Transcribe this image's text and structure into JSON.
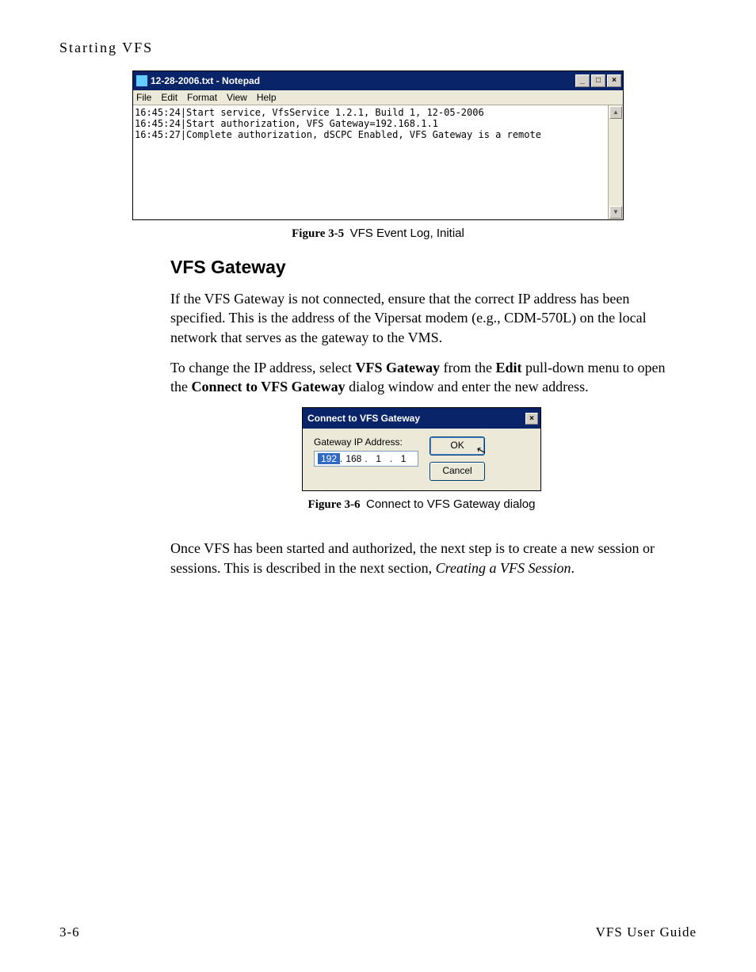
{
  "running_head": "Starting VFS",
  "notepad": {
    "title": "12-28-2006.txt - Notepad",
    "menu": [
      "File",
      "Edit",
      "Format",
      "View",
      "Help"
    ],
    "win_buttons": {
      "min": "_",
      "max": "□",
      "close": "×"
    },
    "scroll": {
      "up": "▲",
      "down": "▼"
    },
    "lines": [
      "16:45:24|Start service, VfsService 1.2.1, Build 1, 12-05-2006",
      "16:45:24|Start authorization, VFS Gateway=192.168.1.1",
      "16:45:27|Complete authorization, dSCPC Enabled, VFS Gateway is a remote"
    ]
  },
  "fig1": {
    "id": "Figure 3-5",
    "text": "VFS Event Log, Initial"
  },
  "section_heading": "VFS Gateway",
  "para1_a": "If the VFS Gateway is not connected, ensure that the correct IP address has been specified. This is the address of the Vipersat modem (e.g., CDM-570L) on the local network that serves as the gateway to the VMS.",
  "para2_a": "To change the IP address, select ",
  "para2_b": "VFS Gateway",
  "para2_c": " from the ",
  "para2_d": "Edit",
  "para2_e": " pull-down menu to open the ",
  "para2_f": "Connect to VFS Gateway",
  "para2_g": " dialog window and enter the new address.",
  "dialog": {
    "title": "Connect to VFS Gateway",
    "close": "×",
    "label": "Gateway IP Address:",
    "octets": [
      "192",
      "168",
      "1",
      "1"
    ],
    "dot": ".",
    "ok": "OK",
    "cancel": "Cancel"
  },
  "fig2": {
    "id": "Figure 3-6",
    "text": "Connect to VFS Gateway dialog"
  },
  "para3_a": "Once VFS has been started and authorized, the next step is to create a new session or sessions. This is described in the next section, ",
  "para3_b": "Creating a VFS Session",
  "para3_c": ".",
  "footer": {
    "page": "3-6",
    "doc": "VFS User Guide"
  }
}
